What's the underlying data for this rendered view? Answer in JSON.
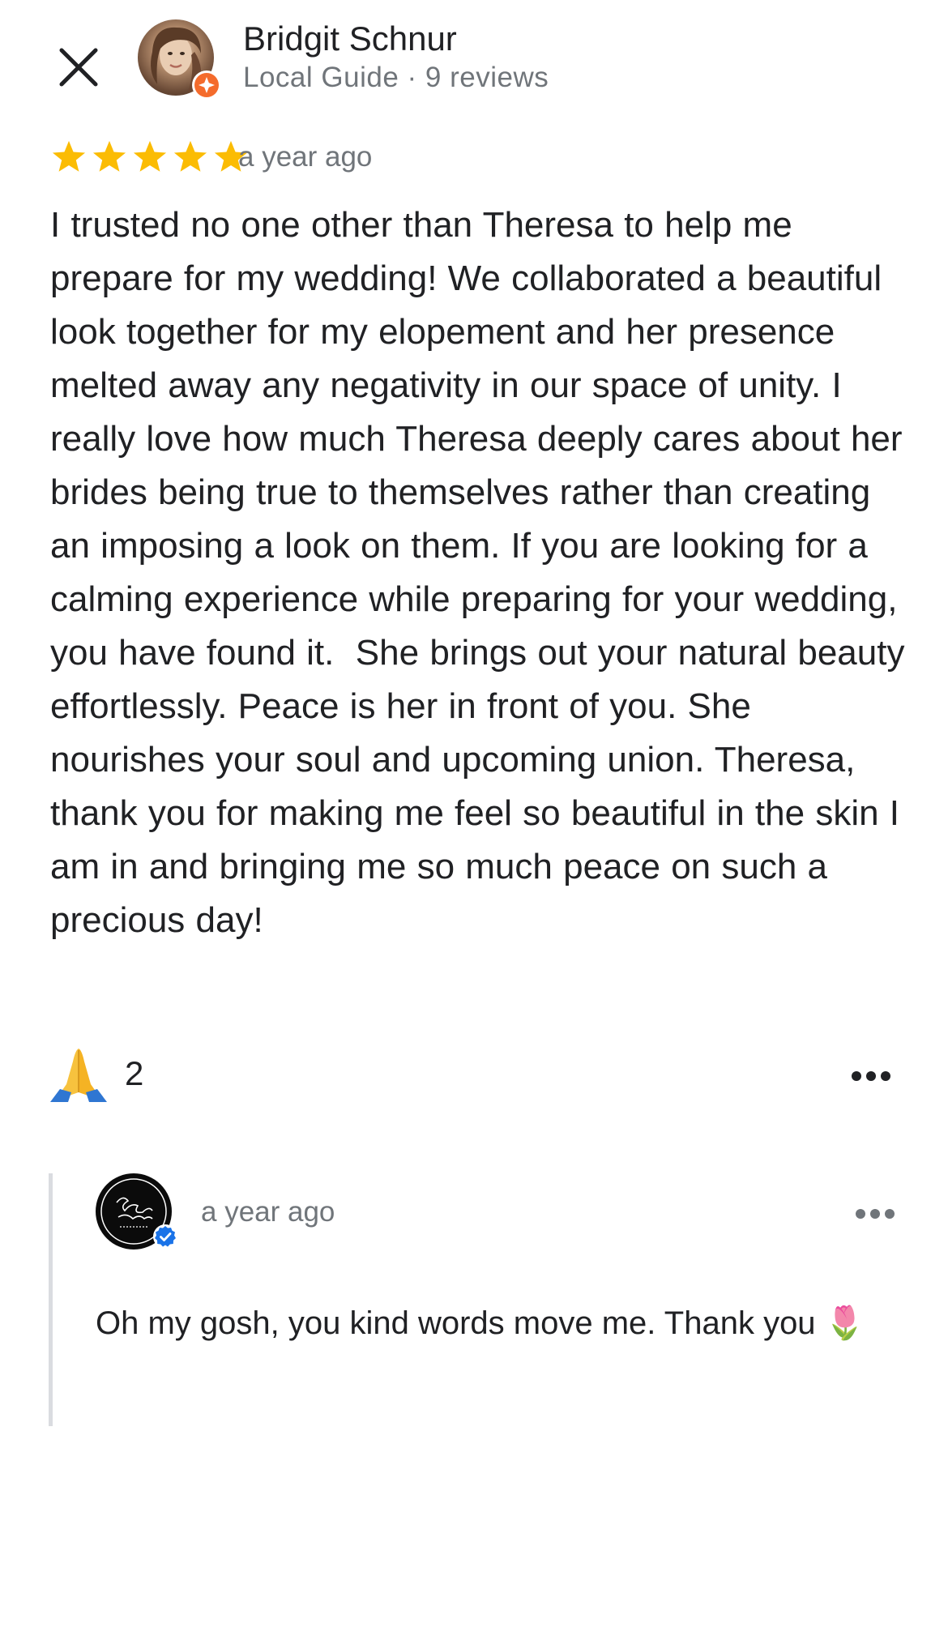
{
  "header": {
    "close_icon": "close-icon",
    "author_name": "Bridgit Schnur",
    "author_meta": "Local Guide · 9 reviews",
    "guide_badge_color": "#f46b2c"
  },
  "review": {
    "rating": 5,
    "max_rating": 5,
    "star_color": "#fbbc04",
    "time": "a year ago",
    "text": "I trusted no one other than Theresa to help me prepare for my wedding! We collaborated a beautiful look together for my elopement and her presence melted away any negativity in our space of unity. I really love how much Theresa deeply cares about her brides being true to themselves rather than creating an imposing a look on them. If you are looking for a calming experience while preparing for your wedding, you have found it.  She brings out your natural beauty effortlessly. Peace is her in front of you. She nourishes your soul and upcoming union. Theresa, thank you for making me feel so beautiful in the skin I am in and bringing me so much peace on such a precious day!",
    "reaction_emoji": "🙏",
    "reaction_count": "2",
    "more_icon": "more-horizontal-icon"
  },
  "owner_reply": {
    "time": "a year ago",
    "text": "Oh my gosh, you kind words move me. Thank you 🌷",
    "verified_color": "#1a73e8",
    "more_icon": "more-horizontal-icon"
  }
}
